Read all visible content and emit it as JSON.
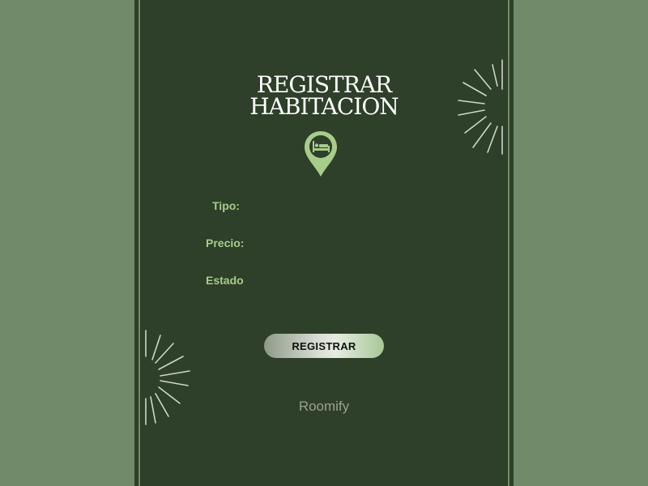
{
  "title": {
    "line1": "REGISTRAR",
    "line2": "HABITACION"
  },
  "form": {
    "tipo_label": "Tipo:",
    "tipo_value": "",
    "precio_label": "Precio:",
    "precio_value": "",
    "estado_label": "Estado",
    "estado_value": ""
  },
  "submit_label": "REGISTRAR",
  "brand": "Roomify",
  "icons": {
    "pin": "location-pin-bed-icon",
    "deco": "sunburst-icon"
  },
  "colors": {
    "background": "#718a69",
    "panel": "#2e3f2a",
    "accent": "#a8cc8a",
    "title": "#ffffff"
  }
}
